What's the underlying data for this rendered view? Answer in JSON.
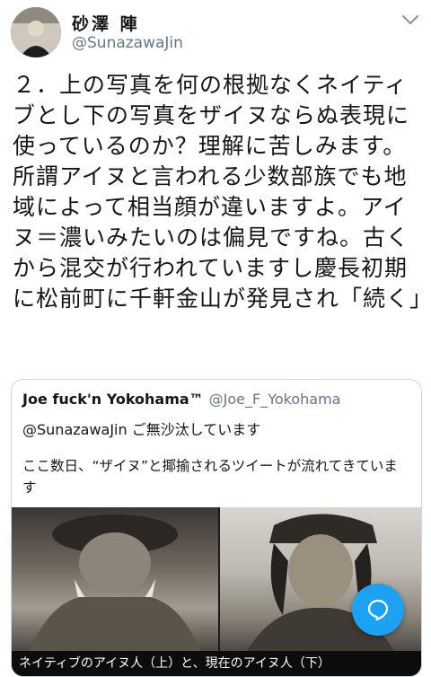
{
  "tweet": {
    "author": {
      "display_name": "砂澤 陣",
      "handle": "@SunazawaJin"
    },
    "text": "２．上の写真を何の根拠なくネイティブとし下の写真をザイヌならぬ表現に使っているのか？理解に苦しみます。所謂アイヌと言われる少数部族でも地域によって相当顔が違いますよ。アイヌ＝濃いみたいのは偏見ですね。古くから混交が行われていますし慶長初期に松前町に千軒金山が発見され「続く」"
  },
  "quoted_tweet": {
    "display_name": "Joe fuck'n Yokohama™",
    "handle": "@Joe_F_Yokohama",
    "reply_to": "@SunazawaJin ご無沙汰しています",
    "text": "ここ数日、“ザイヌ”と揶揄されるツイートが流れてきています",
    "image_caption": "ネイティブのアイヌ人（上）と、現在のアイヌ人（下）"
  },
  "icons": {
    "menu": "chevron-down-icon",
    "compose": "compose-reply-icon"
  },
  "colors": {
    "accent": "#1da1f2",
    "secondary_text": "#657786"
  }
}
